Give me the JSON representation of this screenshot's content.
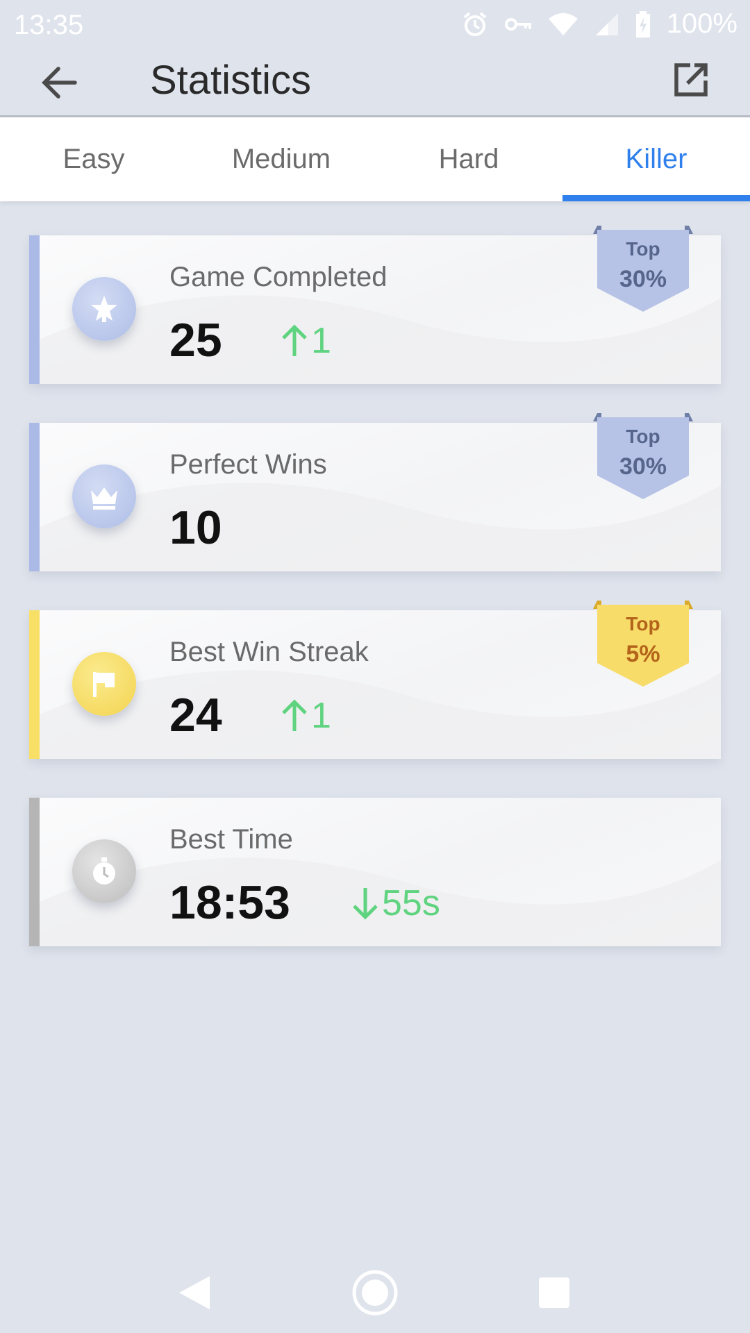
{
  "status": {
    "time": "13:35",
    "battery": "100%",
    "icons": [
      "alarm-icon",
      "vpn-key-icon",
      "wifi-icon",
      "signal-icon",
      "battery-charging-icon"
    ]
  },
  "header": {
    "title": "Statistics",
    "back_icon": "arrow-left-icon",
    "share_icon": "open-external-icon"
  },
  "tabs": [
    {
      "label": "Easy",
      "active": false
    },
    {
      "label": "Medium",
      "active": false
    },
    {
      "label": "Hard",
      "active": false
    },
    {
      "label": "Killer",
      "active": true
    }
  ],
  "colors": {
    "accent_blue": "#2f80ed",
    "delta_green": "#5fd37f",
    "badge_blue": "#b7c3e6",
    "badge_gold": "#f7dc6a"
  },
  "stats": [
    {
      "label": "Game Completed",
      "value": "25",
      "delta": "1",
      "delta_dir": "up",
      "badge_top": "Top",
      "badge_pct": "30%",
      "badge_style": "blue",
      "icon": "star-icon"
    },
    {
      "label": "Perfect Wins",
      "value": "10",
      "delta": "",
      "delta_dir": "",
      "badge_top": "Top",
      "badge_pct": "30%",
      "badge_style": "blue",
      "icon": "crown-icon"
    },
    {
      "label": "Best Win Streak",
      "value": "24",
      "delta": "1",
      "delta_dir": "up",
      "badge_top": "Top",
      "badge_pct": "5%",
      "badge_style": "gold",
      "icon": "flag-icon"
    },
    {
      "label": "Best Time",
      "value": "18:53",
      "delta": "55s",
      "delta_dir": "down",
      "badge_top": "",
      "badge_pct": "",
      "badge_style": "",
      "icon": "stopwatch-icon"
    }
  ],
  "nav": [
    "back-nav-icon",
    "home-nav-icon",
    "recents-nav-icon"
  ]
}
